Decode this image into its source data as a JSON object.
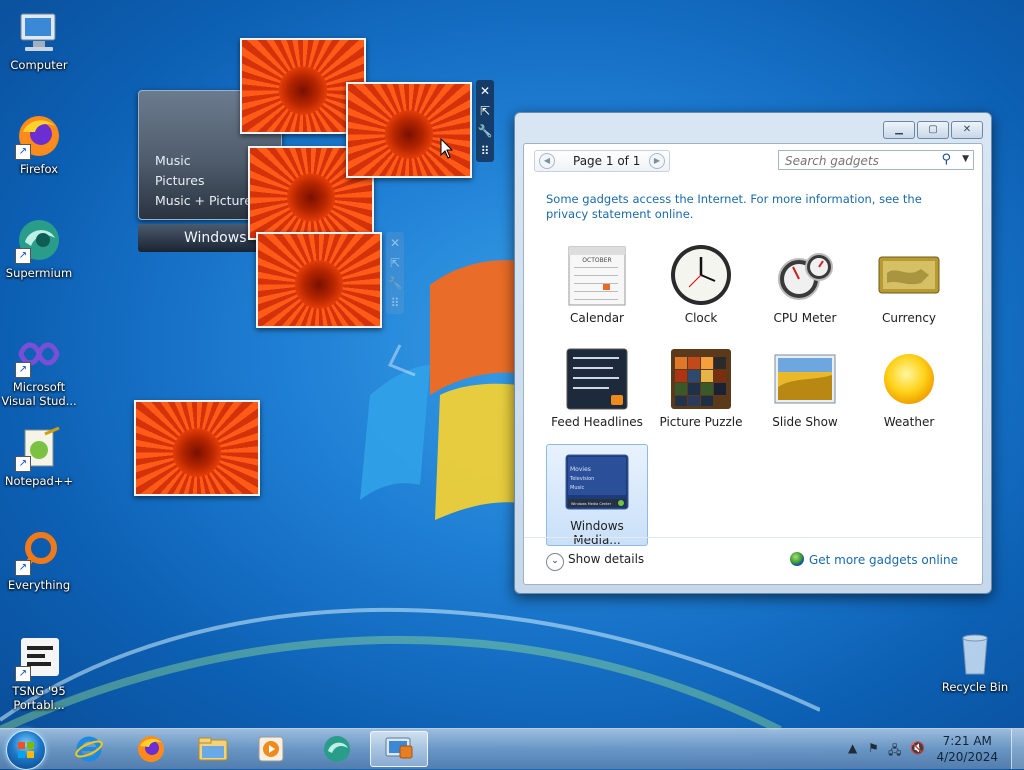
{
  "desktop": {
    "icons": [
      {
        "label": "Computer",
        "icon": "computer-icon",
        "shortcut": false
      },
      {
        "label": "Firefox",
        "icon": "firefox-icon",
        "shortcut": true
      },
      {
        "label": "Supermium",
        "icon": "supermium-icon",
        "shortcut": true
      },
      {
        "label": "Microsoft Visual Stud...",
        "icon": "visual-studio-icon",
        "shortcut": true
      },
      {
        "label": "Notepad++",
        "icon": "notepad-plus-plus-icon",
        "shortcut": true
      },
      {
        "label": "Everything",
        "icon": "everything-search-icon",
        "shortcut": true
      },
      {
        "label": "TSNG '95 Portabl...",
        "icon": "tsng-icon",
        "shortcut": true
      },
      {
        "label": "Recycle Bin",
        "icon": "recycle-bin-icon",
        "shortcut": false
      }
    ]
  },
  "media_center_gadget": {
    "menu": [
      "Music",
      "Pictures",
      "Music + Pictures"
    ],
    "bar_label": "Windows"
  },
  "gallery": {
    "pager_label": "Page 1 of 1",
    "search_placeholder": "Search gadgets",
    "notice": "Some gadgets access the Internet.  For more information, see the privacy statement online.",
    "items": [
      {
        "name": "Calendar",
        "icon": "calendar-gadget-icon",
        "selected": false
      },
      {
        "name": "Clock",
        "icon": "clock-gadget-icon",
        "selected": false
      },
      {
        "name": "CPU Meter",
        "icon": "cpu-meter-gadget-icon",
        "selected": false
      },
      {
        "name": "Currency",
        "icon": "currency-gadget-icon",
        "selected": false
      },
      {
        "name": "Feed Headlines",
        "icon": "feed-headlines-gadget-icon",
        "selected": false
      },
      {
        "name": "Picture Puzzle",
        "icon": "picture-puzzle-gadget-icon",
        "selected": false
      },
      {
        "name": "Slide Show",
        "icon": "slide-show-gadget-icon",
        "selected": false
      },
      {
        "name": "Weather",
        "icon": "weather-gadget-icon",
        "selected": false
      },
      {
        "name": "Windows Media...",
        "icon": "windows-media-center-gadget-icon",
        "selected": true
      }
    ],
    "show_details_label": "Show details",
    "get_more_label": "Get more gadgets online",
    "calendar_month": "OCTOBER",
    "wmc_thumb_lines": [
      "Movies",
      "Television",
      "Music"
    ],
    "wmc_thumb_bar": "Windows Media Center"
  },
  "taskbar": {
    "pinned": [
      "internet-explorer-icon",
      "firefox-icon",
      "file-explorer-icon",
      "media-player-icon",
      "supermium-icon",
      "gadgets-icon"
    ],
    "active_index": 5,
    "time": "7:21 AM",
    "date": "4/20/2024"
  },
  "colors": {
    "accent": "#1a6aaa",
    "wallpaper": "#1f7fd4",
    "flower": "#e4440d"
  }
}
